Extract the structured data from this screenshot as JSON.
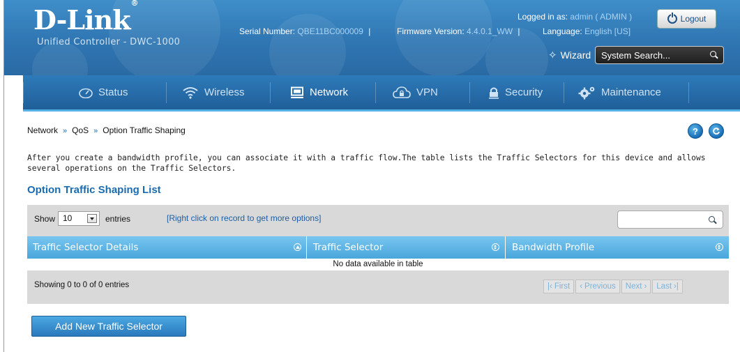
{
  "header": {
    "logo": "D-Link",
    "product": "Unified Controller - DWC-1000",
    "serial_label": "Serial Number:",
    "serial_value": "QBE11BC000009",
    "firmware_label": "Firmware Version:",
    "firmware_value": "4.4.0.1_WW",
    "language_label": "Language:",
    "language_value": "English [US]",
    "logged_label": "Logged in as:",
    "logged_value": "admin ( ADMIN )",
    "logout": "Logout",
    "wizard": "Wizard",
    "search_placeholder": "System Search..."
  },
  "nav": [
    {
      "label": "Status",
      "icon": "status-gauge-icon"
    },
    {
      "label": "Wireless",
      "icon": "wifi-icon"
    },
    {
      "label": "Network",
      "icon": "monitor-icon",
      "active": true
    },
    {
      "label": "VPN",
      "icon": "cloud-lock-icon"
    },
    {
      "label": "Security",
      "icon": "lock-icon"
    },
    {
      "label": "Maintenance",
      "icon": "gears-icon"
    }
  ],
  "breadcrumb": [
    "Network",
    "QoS",
    "Option Traffic Shaping"
  ],
  "breadcrumb_sep": "»",
  "help_label": "?",
  "description": "After you create a bandwidth profile, you can associate it with a traffic flow.The table lists the Traffic Selectors for this device and allows several operations on the Traffic Selectors.",
  "section_title": "Option Traffic Shaping List",
  "table": {
    "show_label": "Show",
    "entries_value": "10",
    "entries_label": "entries",
    "hint": "[Right click on record to get more options]",
    "columns": [
      "Traffic Selector Details",
      "Traffic Selector",
      "Bandwidth Profile"
    ],
    "empty_text": "No data available in table",
    "info": "Showing 0 to 0 of 0 entries",
    "pager": {
      "first": "First",
      "previous": "Previous",
      "next": "Next",
      "last": "Last"
    }
  },
  "add_button": "Add New Traffic Selector",
  "colors": {
    "accent": "#2f76b3",
    "table_header": "#4aa6dc",
    "title": "#1a6bb0"
  }
}
